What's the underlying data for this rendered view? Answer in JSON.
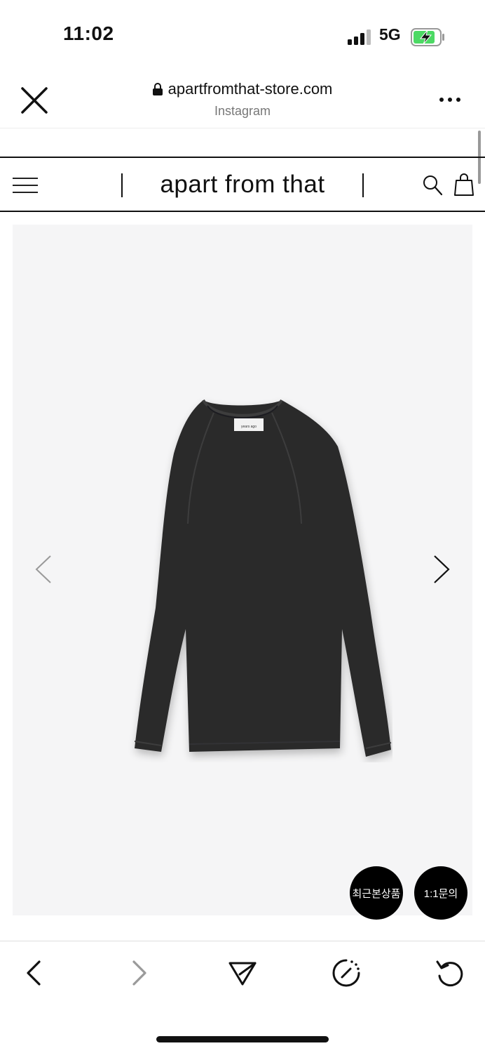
{
  "status": {
    "time": "11:02",
    "network": "5G",
    "battery_color": "#4cd964"
  },
  "browser": {
    "url": "apartfromthat-store.com",
    "source": "Instagram"
  },
  "site": {
    "brand": "apart from that"
  },
  "product": {
    "label_text": "years ago",
    "garment_color": "#2a2a2b",
    "background_color": "#f5f5f6"
  },
  "floating": {
    "recent": "최근본상품",
    "inquiry": "1:1문의"
  },
  "icons": {
    "close": "close-icon",
    "lock": "lock-icon",
    "more": "more-icon",
    "menu": "hamburger-icon",
    "search": "search-icon",
    "bag": "bag-icon",
    "prev": "chevron-left-icon",
    "next": "chevron-right-icon",
    "back": "back-icon",
    "forward": "forward-icon",
    "share": "send-icon",
    "compass": "compass-icon",
    "reload": "reload-icon"
  }
}
